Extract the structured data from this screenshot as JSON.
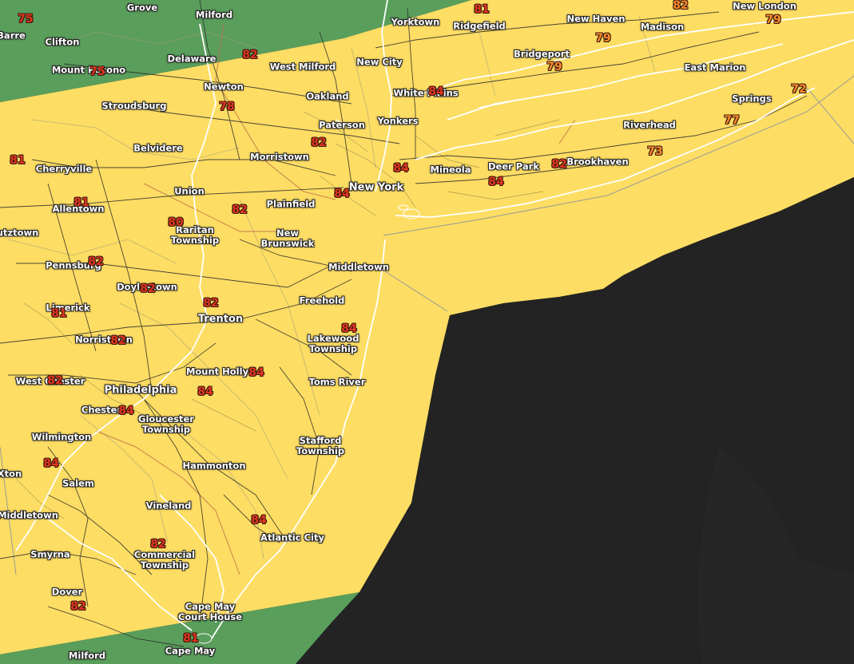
{
  "map": {
    "colors": {
      "water": "#222222",
      "yellow_zone": "#fddd63",
      "green_zone": "#5a9e5c",
      "roads": "#2a2a2a",
      "boundaries": "#9a9a9a",
      "coast": "#ffffff",
      "temp_text": "#e0351f"
    },
    "places": [
      "Grove",
      "Barre",
      "Milford",
      "Clifton",
      "Delaware",
      "West Milford",
      "Mount Pocono",
      "Stroudsburg",
      "Newton",
      "Belvidere",
      "Cherryville",
      "Allentown",
      "Union",
      "Raritan\nTownship",
      "utztown",
      "Pennsburg",
      "Doylestown",
      "Limerick",
      "Norristown",
      "West Chester",
      "Philadelphia",
      "Chester",
      "Wilmington",
      "Salem",
      "Middletown",
      "Smyrna",
      "Dover",
      "Milford",
      "Trenton",
      "Mount Holly",
      "Gloucester\nTownship",
      "Hammonton",
      "Vineland",
      "Commercial\nTownship",
      "Cape May\nCourt House",
      "Cape May",
      "Atlantic City",
      "Stafford\nTownship",
      "Toms River",
      "Lakewood\nTownship",
      "Freehold",
      "Middletown",
      "New\nBrunswick",
      "Plainfield",
      "New York",
      "Morristown",
      "Paterson",
      "Oakland",
      "Yonkers",
      "White Plains",
      "New City",
      "Yorktown",
      "Ridgefield",
      "New Haven",
      "Madison",
      "New London",
      "Bridgeport",
      "East Marion",
      "Springs",
      "Riverhead",
      "Brookhaven",
      "Deer Park",
      "Mineola",
      "Xton"
    ],
    "temperatures": [
      "75",
      "75",
      "82",
      "78",
      "81",
      "81",
      "80",
      "82",
      "82",
      "82",
      "81",
      "82",
      "82",
      "84",
      "84",
      "84",
      "84",
      "82",
      "84",
      "82",
      "82",
      "81",
      "84",
      "84",
      "82",
      "84",
      "81",
      "79",
      "79",
      "82",
      "79",
      "72",
      "77",
      "73",
      "82",
      "84",
      "84"
    ]
  }
}
